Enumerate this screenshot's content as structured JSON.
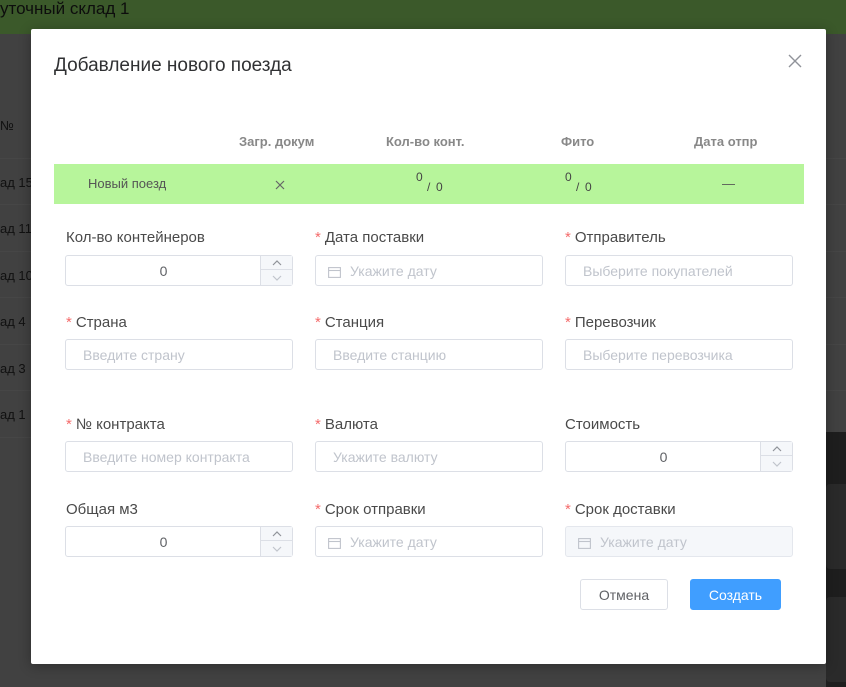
{
  "background": {
    "title": "уточный склад 1",
    "hash": "№",
    "rows": [
      "ад 15",
      "ад 11",
      "ад 10",
      "ад 4",
      "ад 3",
      "ад 1"
    ]
  },
  "dialog": {
    "title": "Добавление нового поезда",
    "close_icon": "close-icon",
    "table": {
      "headers": [
        "Загр. докум",
        "Кол-во конт.",
        "Фито",
        "Дата отпр"
      ],
      "row": {
        "name": "Новый поезд",
        "doc_icon": "close-icon",
        "containers_num": "0",
        "containers_den": "0",
        "fito_num": "0",
        "fito_den": "0",
        "date": "—",
        "highlight_color": "#b7f59b"
      }
    },
    "form": {
      "containers_count": {
        "label": "Кол-во контейнеров",
        "value": "0"
      },
      "delivery_date": {
        "label": "Дата поставки",
        "placeholder": "Укажите дату"
      },
      "sender": {
        "label": "Отправитель",
        "placeholder": "Выберите покупателей"
      },
      "country": {
        "label": "Страна",
        "placeholder": "Введите страну"
      },
      "station": {
        "label": "Станция",
        "placeholder": "Введите станцию"
      },
      "carrier": {
        "label": "Перевозчик",
        "placeholder": "Выберите перевозчика"
      },
      "contract": {
        "label": "№ контракта",
        "placeholder": "Введите номер контракта"
      },
      "currency": {
        "label": "Валюта",
        "placeholder": "Укажите валюту"
      },
      "cost": {
        "label": "Стоимость",
        "value": "0"
      },
      "total_m3": {
        "label": "Общая м3",
        "value": "0"
      },
      "ship_term": {
        "label": "Срок отправки",
        "placeholder": "Укажите дату"
      },
      "delivery_term": {
        "label": "Срок доставки",
        "placeholder": "Укажите дату"
      },
      "required_mark": "*"
    },
    "buttons": {
      "cancel": "Отмена",
      "create": "Создать"
    },
    "colors": {
      "primary": "#409eff",
      "required": "#f56c6c",
      "header_bg": "#76b254"
    }
  }
}
